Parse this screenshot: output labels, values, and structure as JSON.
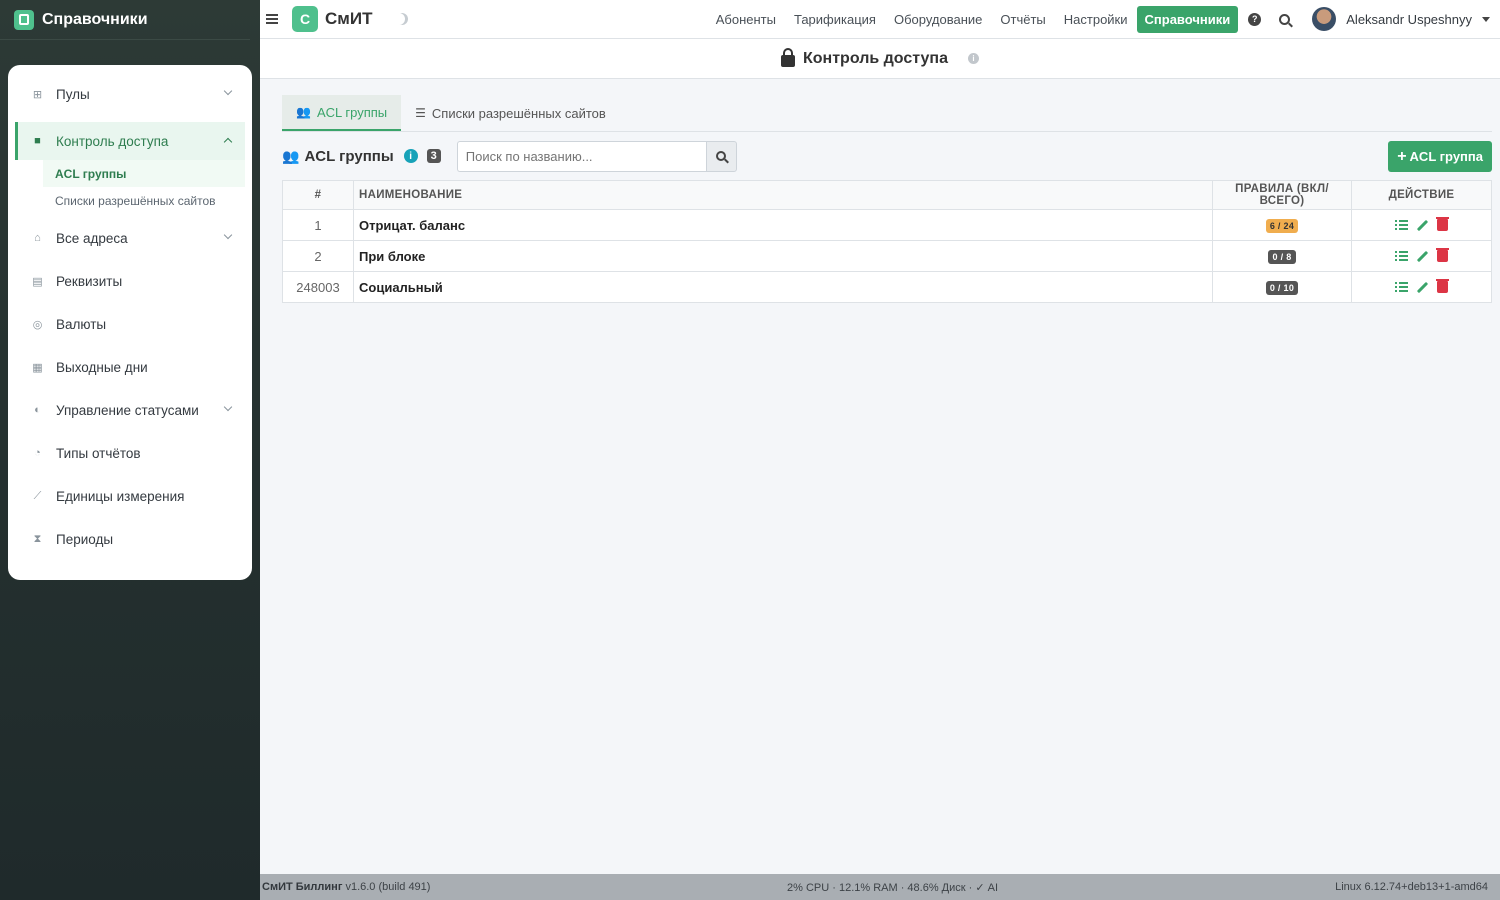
{
  "brand": {
    "title": "Справочники"
  },
  "sidebar": {
    "items": [
      {
        "label": "Пулы",
        "icon": "sitemap-icon"
      },
      {
        "label": "Контроль доступа",
        "icon": "lock-icon"
      },
      {
        "label": "Все адреса",
        "icon": "home-icon"
      },
      {
        "label": "Реквизиты",
        "icon": "card-icon"
      },
      {
        "label": "Валюты",
        "icon": "coins-icon"
      },
      {
        "label": "Выходные дни",
        "icon": "calendar-icon"
      },
      {
        "label": "Управление статусами",
        "icon": "toggle-icon"
      },
      {
        "label": "Типы отчётов",
        "icon": "chart-pie-icon"
      },
      {
        "label": "Единицы измерения",
        "icon": "ruler-icon"
      },
      {
        "label": "Периоды",
        "icon": "hourglass-icon"
      }
    ],
    "subitems": [
      {
        "label": "ACL группы"
      },
      {
        "label": "Списки разрешённых сайтов"
      }
    ]
  },
  "topbar": {
    "logo_letter": "С",
    "logo_text": "СмИТ",
    "links": [
      "Абоненты",
      "Тарификация",
      "Оборудование",
      "Отчёты",
      "Настройки",
      "Справочники"
    ],
    "help": "?",
    "user": "Aleksandr Uspeshnyy"
  },
  "page": {
    "title": "Контроль доступа",
    "info": "i"
  },
  "tabs": [
    {
      "label": "ACL группы"
    },
    {
      "label": "Списки разрешённых сайтов"
    }
  ],
  "toolbar": {
    "title": "ACL группы",
    "info": "i",
    "count": "3",
    "search_placeholder": "Поиск по названию...",
    "add_label": "ACL группа"
  },
  "table": {
    "headers": [
      "#",
      "НАИМЕНОВАНИЕ",
      "ПРАВИЛА (ВКЛ/ВСЕГО)",
      "ДЕЙСТВИЕ"
    ],
    "rows": [
      {
        "id": "1",
        "name": "Отрицат. баланс",
        "rules": "6 / 24"
      },
      {
        "id": "2",
        "name": "При блоке",
        "rules": "0 / 8"
      },
      {
        "id": "248003",
        "name": "Социальный",
        "rules": "0 / 10"
      }
    ]
  },
  "footer": {
    "app": "СмИТ Биллинг",
    "version": " v1.6.0 (build 491)",
    "stats": "2% CPU · 12.1% RAM · 48.6% Диск · ✓ AI",
    "os": "Linux 6.12.74+deb13+1-amd64"
  },
  "colors": {
    "accent": "#3aa46a",
    "danger": "#dc3545",
    "warning": "#f0ad4e",
    "info": "#17a2b8"
  }
}
